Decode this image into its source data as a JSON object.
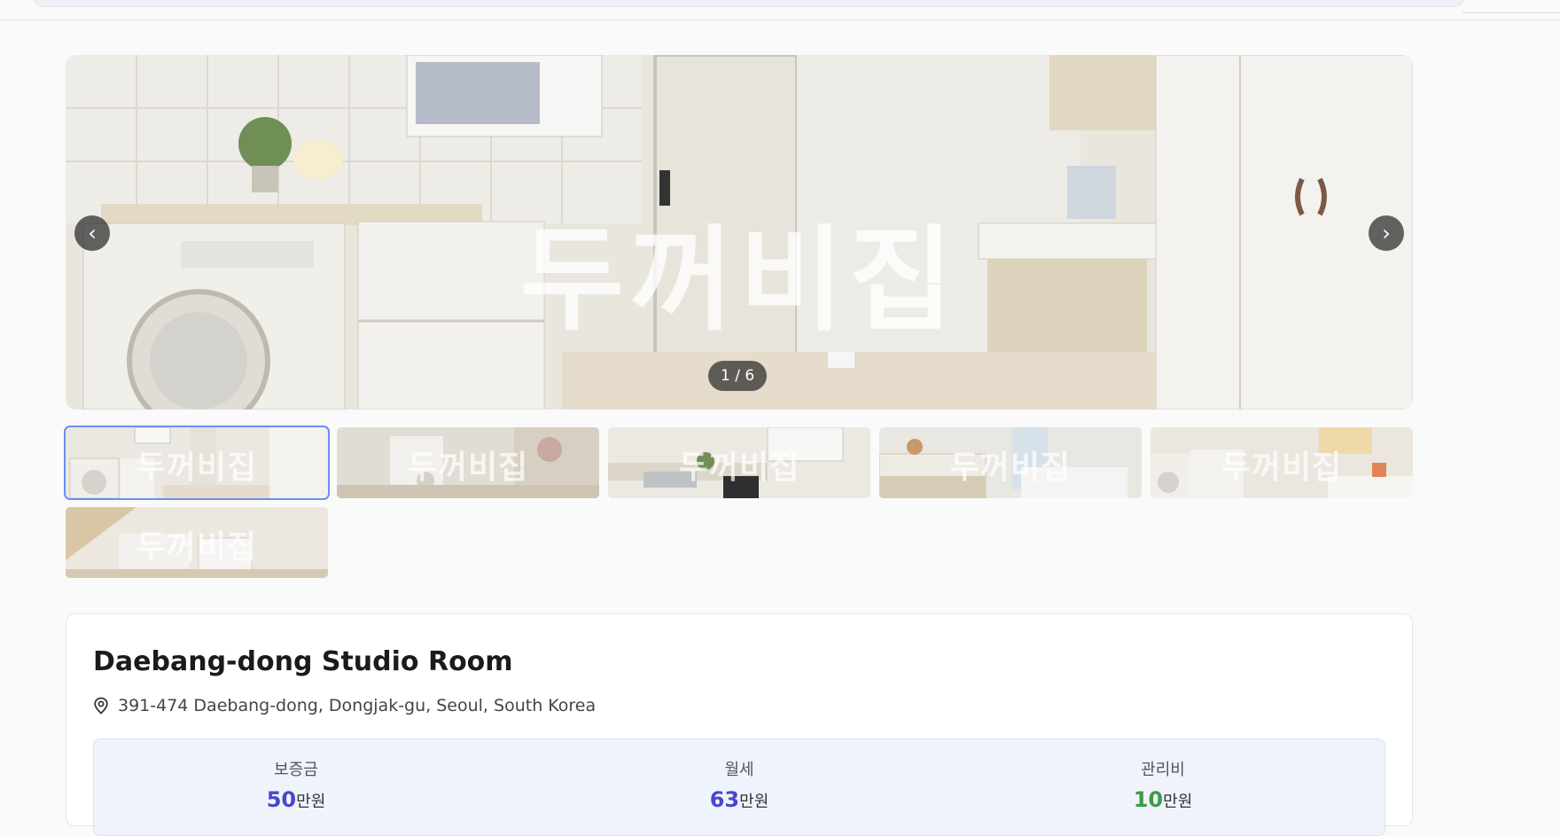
{
  "gallery": {
    "watermark": "두꺼비집",
    "counter": "1 / 6",
    "prev_label": "‹",
    "next_label": "›",
    "thumbnails": [
      {
        "watermark": "두꺼비집"
      },
      {
        "watermark": "두꺼비집"
      },
      {
        "watermark": "두꺼비집"
      },
      {
        "watermark": "두꺼비집"
      },
      {
        "watermark": "두꺼비집"
      },
      {
        "watermark": "두꺼비집"
      }
    ],
    "active_index": 0
  },
  "listing": {
    "title": "Daebang-dong Studio Room",
    "address": "391-474 Daebang-dong, Dongjak-gu, Seoul, South Korea",
    "pin_icon": "location-pin-icon"
  },
  "prices": [
    {
      "label": "보증금",
      "amount": "50",
      "unit": "만원",
      "color": "#4a47c8"
    },
    {
      "label": "월세",
      "amount": "63",
      "unit": "만원",
      "color": "#4a47c8"
    },
    {
      "label": "관리비",
      "amount": "10",
      "unit": "만원",
      "color": "#3e9a48"
    }
  ]
}
